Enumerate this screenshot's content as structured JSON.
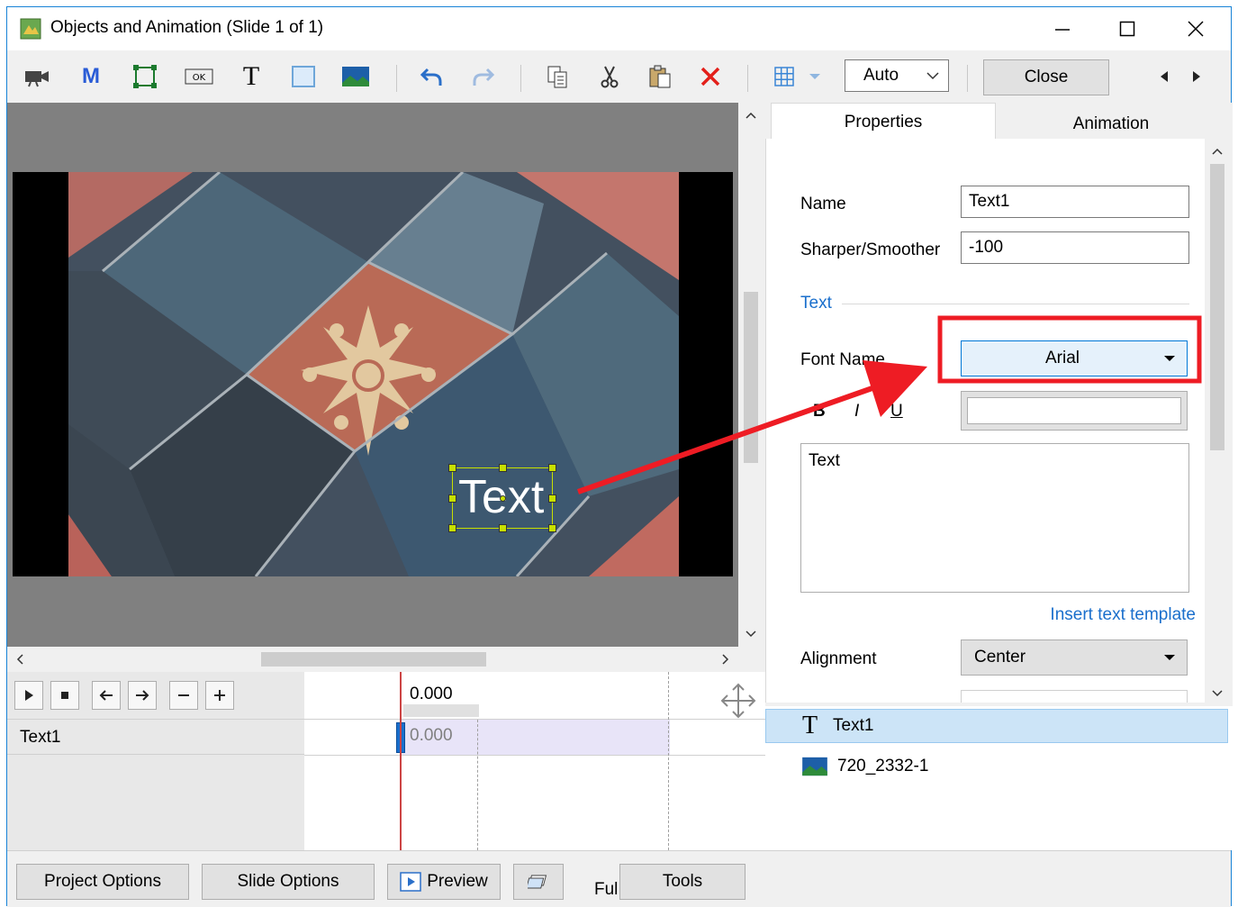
{
  "window": {
    "title": "Objects and Animation (Slide 1 of 1)"
  },
  "toolbar": {
    "zoom_value": "Auto",
    "close_label": "Close"
  },
  "canvas": {
    "text_object": "Text"
  },
  "tabs": {
    "properties": "Properties",
    "animation": "Animation"
  },
  "properties": {
    "name_label": "Name",
    "name_value": "Text1",
    "sharper_label": "Sharper/Smoother",
    "sharper_value": "-100",
    "text_section": "Text",
    "font_name_label": "Font Name",
    "font_name_value": "Arial",
    "bold": "B",
    "italic": "I",
    "underline": "U",
    "text_content": "Text",
    "insert_template": "Insert text template",
    "alignment_label": "Alignment",
    "alignment_value": "Center"
  },
  "timeline": {
    "time_header": "0.000",
    "row_label": "Text1",
    "row_time": "0.000"
  },
  "objects": [
    {
      "label": "Text1"
    },
    {
      "label": "720_2332-1"
    }
  ],
  "bottom": {
    "project_options": "Project Options",
    "slide_options": "Slide Options",
    "preview": "Preview",
    "full": "Ful",
    "tools": "Tools"
  },
  "colors": {
    "accent": "#1883d7",
    "highlight_red": "#ee1c24",
    "selection": "#cce4f7",
    "link": "#1a6fcc"
  }
}
